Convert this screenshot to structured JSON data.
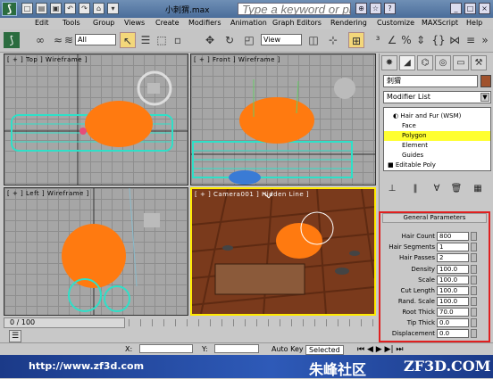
{
  "title": {
    "file_name": "小刺猬.max",
    "search_placeholder": "Type a keyword or phrase"
  },
  "menu": [
    "Edit",
    "Tools",
    "Group",
    "Views",
    "Create",
    "Modifiers",
    "Animation",
    "Graph Editors",
    "Rendering",
    "Customize",
    "MAXScript",
    "Help"
  ],
  "toolbar": {
    "selection_filter": "All",
    "reference_coord": "View"
  },
  "viewports": {
    "top": "[ + ] Top ] Wireframe ]",
    "front": "[ + ] Front ] Wireframe ]",
    "left": "[ + ] Left ] Wireframe ]",
    "camera": "[ + ] Camera001 ] Hidden Line ]"
  },
  "command_panel": {
    "object_name": "刺猬",
    "modifier_list": "Modifier List",
    "stack": [
      "Hair and Fur (WSM)",
      "Polygon",
      "Element",
      "Guides",
      "Editable Poly"
    ]
  },
  "general_parameters": {
    "header": "General Parameters",
    "params": [
      {
        "label": "Hair Count",
        "value": "800"
      },
      {
        "label": "Hair Segments",
        "value": "1"
      },
      {
        "label": "Hair Passes",
        "value": "2"
      },
      {
        "label": "Density",
        "value": "100.0"
      },
      {
        "label": "Scale",
        "value": "100.0"
      },
      {
        "label": "Cut Length",
        "value": "100.0"
      },
      {
        "label": "Rand. Scale",
        "value": "100.0"
      },
      {
        "label": "Root Thick",
        "value": "70.0"
      },
      {
        "label": "Tip Thick",
        "value": "0.0"
      },
      {
        "label": "Displacement",
        "value": "0.0"
      }
    ]
  },
  "timeline": {
    "frame": "0 / 100"
  },
  "status": {
    "x_label": "X:",
    "y_label": "Y:",
    "autokey": "Auto Key",
    "selected": "Selected"
  },
  "footer": {
    "url": "http://www.zf3d.com",
    "cn": "朱峰社区",
    "en": "ZF3D.COM"
  },
  "colors": {
    "accent": "#ffff30",
    "highlight_border": "#e02020",
    "brand": "#2b6c3f"
  }
}
